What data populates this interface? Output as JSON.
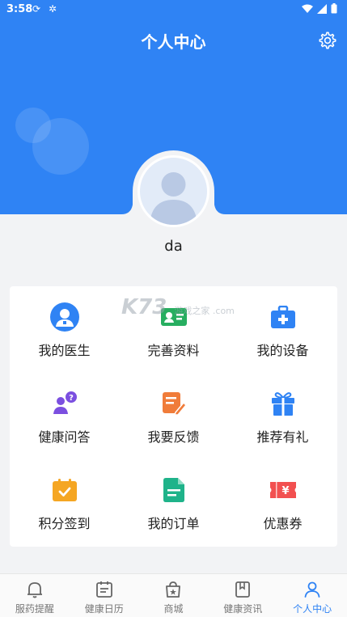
{
  "status_bar": {
    "time": "3:58"
  },
  "header": {
    "title": "个人中心"
  },
  "profile": {
    "username": "da"
  },
  "watermark": {
    "text": "K73",
    "sub": "游戏之家 .com"
  },
  "menu": [
    {
      "label": "我的医生",
      "icon": "doctor-icon",
      "color": "#2f83f4"
    },
    {
      "label": "完善资料",
      "icon": "profile-card-icon",
      "color": "#27ae60"
    },
    {
      "label": "我的设备",
      "icon": "medical-kit-icon",
      "color": "#2f83f4"
    },
    {
      "label": "健康问答",
      "icon": "question-user-icon",
      "color": "#7b4fe0"
    },
    {
      "label": "我要反馈",
      "icon": "feedback-edit-icon",
      "color": "#f07c3a"
    },
    {
      "label": "推荐有礼",
      "icon": "gift-icon",
      "color": "#2f83f4"
    },
    {
      "label": "积分签到",
      "icon": "calendar-check-icon",
      "color": "#f5a623"
    },
    {
      "label": "我的订单",
      "icon": "order-document-icon",
      "color": "#1fb38a"
    },
    {
      "label": "优惠券",
      "icon": "coupon-yen-icon",
      "color": "#f25050"
    }
  ],
  "tabs": [
    {
      "label": "服药提醒",
      "icon": "bell-icon",
      "active": false
    },
    {
      "label": "健康日历",
      "icon": "calendar-icon",
      "active": false
    },
    {
      "label": "商城",
      "icon": "shopping-bag-icon",
      "active": false
    },
    {
      "label": "健康资讯",
      "icon": "bookmark-book-icon",
      "active": false
    },
    {
      "label": "个人中心",
      "icon": "person-icon",
      "active": true
    }
  ],
  "colors": {
    "primary": "#2f83f4",
    "background": "#f2f3f5"
  }
}
